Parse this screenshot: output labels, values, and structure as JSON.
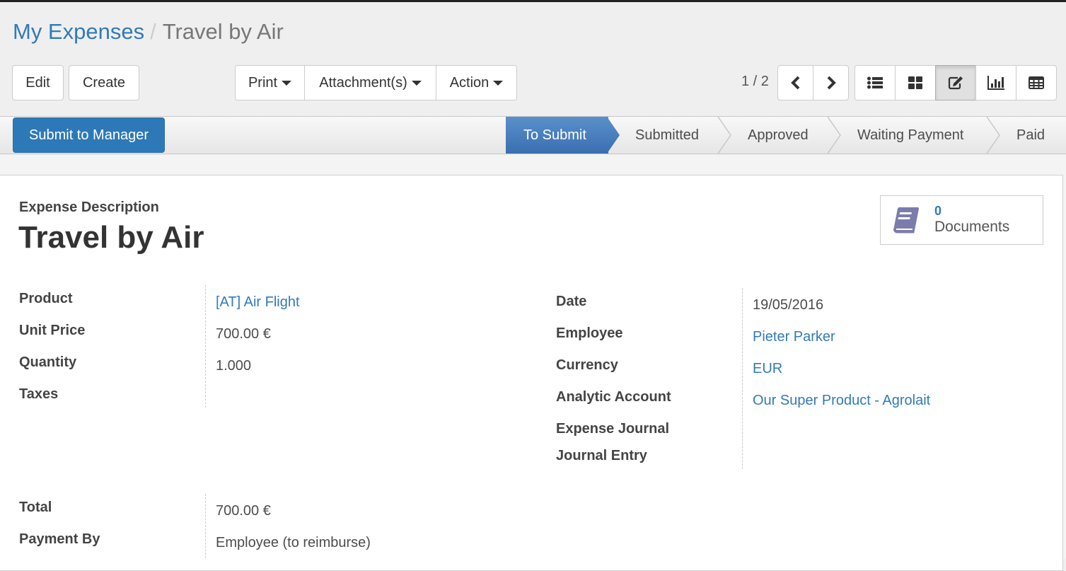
{
  "breadcrumb": {
    "parent": "My Expenses",
    "separator": "/",
    "current": "Travel by Air"
  },
  "toolbar": {
    "edit": "Edit",
    "create": "Create",
    "print": "Print",
    "attachments": "Attachment(s)",
    "action": "Action"
  },
  "pager": {
    "value": "1 / 2",
    "prev_icon": "chevron-left-icon",
    "next_icon": "chevron-right-icon"
  },
  "view_switcher": [
    {
      "name": "list",
      "icon": "list-icon",
      "active": false
    },
    {
      "name": "kanban",
      "icon": "kanban-icon",
      "active": false
    },
    {
      "name": "form",
      "icon": "edit-icon",
      "active": true
    },
    {
      "name": "graph",
      "icon": "bar-chart-icon",
      "active": false
    },
    {
      "name": "pivot",
      "icon": "table-icon",
      "active": false
    }
  ],
  "statusbar": {
    "submit_button": "Submit to Manager",
    "stages": [
      {
        "label": "To Submit",
        "current": true
      },
      {
        "label": "Submitted",
        "current": false
      },
      {
        "label": "Approved",
        "current": false
      },
      {
        "label": "Waiting Payment",
        "current": false
      },
      {
        "label": "Paid",
        "current": false
      }
    ]
  },
  "form": {
    "caption": "Expense Description",
    "title": "Travel by Air",
    "documents": {
      "count": "0",
      "label": "Documents",
      "icon": "book-icon",
      "icon_color": "#7c7bad"
    },
    "left_group": [
      {
        "label": "Product",
        "value": "[AT] Air Flight",
        "link": true
      },
      {
        "label": "Unit Price",
        "value": "700.00 €",
        "link": false
      },
      {
        "label": "Quantity",
        "value": "1.000",
        "link": false
      },
      {
        "label": "Taxes",
        "value": "",
        "link": false
      }
    ],
    "right_group": [
      {
        "label": "Date",
        "value": "19/05/2016",
        "link": false
      },
      {
        "label": "Employee",
        "value": "Pieter Parker",
        "link": true
      },
      {
        "label": "Currency",
        "value": "EUR",
        "link": true
      },
      {
        "label": "Analytic Account",
        "value": "Our Super Product - Agrolait",
        "link": true
      },
      {
        "label": "Expense Journal",
        "value": "",
        "link": false
      },
      {
        "label": "Journal Entry",
        "value": "",
        "link": false
      }
    ],
    "bottom_group": [
      {
        "label": "Total",
        "value": "700.00 €",
        "link": false
      },
      {
        "label": "Payment By",
        "value": "Employee (to reimburse)",
        "link": false
      }
    ]
  },
  "colors": {
    "link": "#337ab7",
    "primary": "#2d79b7",
    "stage_current": "#4a7fc1"
  }
}
